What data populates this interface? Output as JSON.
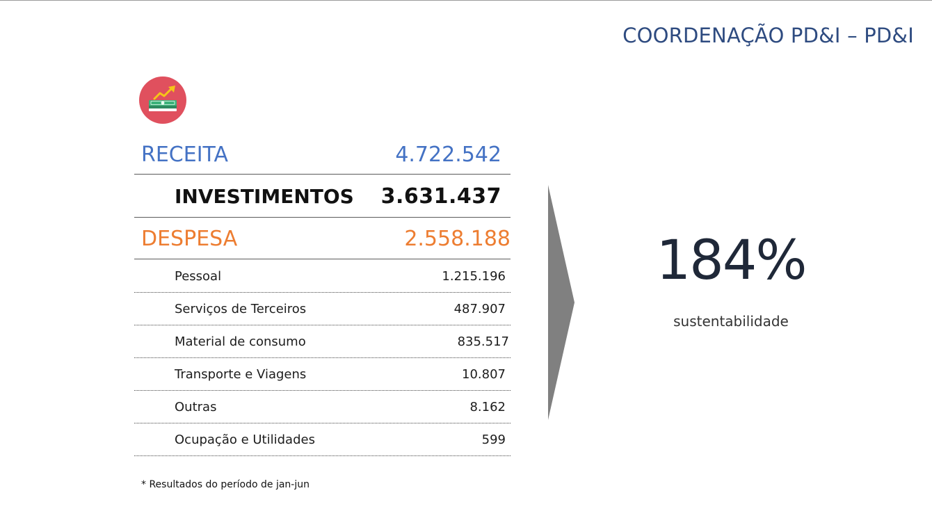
{
  "header": {
    "title": "COORDENAÇÃO PD&I – PD&I"
  },
  "badge": {
    "icon": "money-growth-icon",
    "color": "#e0505e"
  },
  "summary": {
    "receita": {
      "label": "RECEITA",
      "value": "4.722.542"
    },
    "investimentos": {
      "label": "INVESTIMENTOS",
      "value": "3.631.437"
    },
    "despesa": {
      "label": "DESPESA",
      "value": "2.558.188"
    }
  },
  "expenses": [
    {
      "label": "Pessoal",
      "value": "1.215.196"
    },
    {
      "label": "Serviços de Terceiros",
      "value": "487.907"
    },
    {
      "label": "Material de consumo",
      "value": "835.517"
    },
    {
      "label": "Transporte e Viagens",
      "value": "10.807"
    },
    {
      "label": "Outras",
      "value": "8.162"
    },
    {
      "label": "Ocupação e Utilidades",
      "value": "599"
    }
  ],
  "footnote": "*  Resultados do período de jan-jun",
  "result": {
    "value": "184%",
    "caption": "sustentabilidade"
  },
  "colors": {
    "title": "#2e4b80",
    "receita": "#4472c4",
    "despesa": "#ed7d31",
    "arrow": "#808080"
  }
}
